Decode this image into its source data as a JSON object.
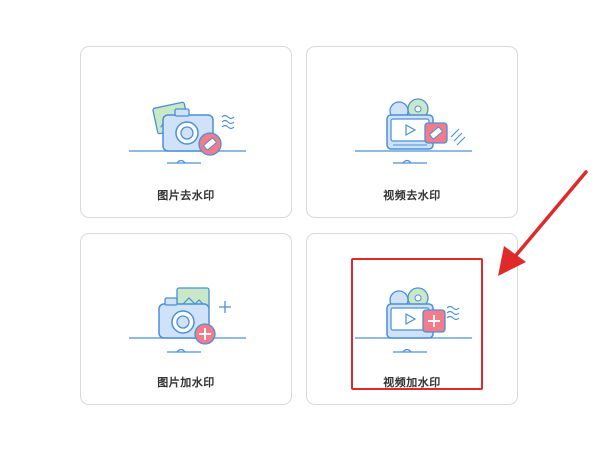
{
  "cards": [
    {
      "label": "图片去水印",
      "icon": "camera-eraser-icon"
    },
    {
      "label": "视频去水印",
      "icon": "video-eraser-icon"
    },
    {
      "label": "图片加水印",
      "icon": "camera-plus-icon"
    },
    {
      "label": "视频加水印",
      "icon": "video-plus-icon"
    }
  ],
  "colors": {
    "line": "#4a90d9",
    "fill_blue": "#cfe2f8",
    "fill_green": "#c9e8c7",
    "badge": "#f47b8a",
    "highlight": "#e02a2a",
    "border": "#d6d9de"
  },
  "annotation": {
    "highlighted_card": "视频加水印"
  }
}
